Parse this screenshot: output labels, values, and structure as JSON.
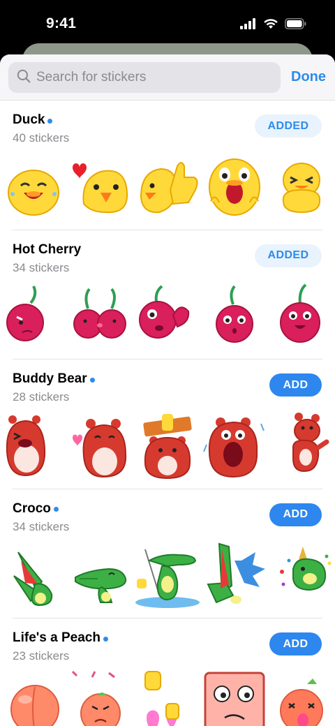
{
  "status_bar": {
    "time": "9:41"
  },
  "search": {
    "placeholder": "Search for stickers"
  },
  "header": {
    "done_label": "Done"
  },
  "packs": [
    {
      "title": "Duck",
      "is_new": true,
      "count": "40 stickers",
      "button": "ADDED",
      "added": true,
      "stickers": [
        "duck-laughing-sticker",
        "duck-heart-sticker",
        "duck-thumbs-up-sticker",
        "duck-shocked-sticker",
        "duck-squinting-sticker"
      ]
    },
    {
      "title": "Hot Cherry",
      "is_new": false,
      "count": "34 stickers",
      "button": "ADDED",
      "added": true,
      "stickers": [
        "cherry-sad-sticker",
        "cherry-pair-kiss-sticker",
        "cherry-waving-sticker",
        "cherry-surprised-sticker",
        "cherry-excited-sticker"
      ]
    },
    {
      "title": "Buddy Bear",
      "is_new": true,
      "count": "28 stickers",
      "button": "ADD",
      "added": false,
      "stickers": [
        "bear-laughing-sticker",
        "bear-blowing-kiss-sticker",
        "bear-thumbs-sign-sticker",
        "bear-screaming-sticker",
        "bear-dancing-sticker"
      ]
    },
    {
      "title": "Croco",
      "is_new": true,
      "count": "34 stickers",
      "button": "ADD",
      "added": false,
      "stickers": [
        "croco-laughing-sticker",
        "croco-lying-sticker",
        "croco-fishing-sticker",
        "croco-shouting-sticker",
        "croco-party-sticker"
      ]
    },
    {
      "title": "Life's a Peach",
      "is_new": true,
      "count": "23 stickers",
      "button": "ADD",
      "added": false,
      "stickers": [
        "peach-plain-sticker",
        "peach-angry-sticker",
        "peach-balloons-sticker",
        "peach-square-face-sticker",
        "peach-tongue-sticker"
      ]
    }
  ],
  "colors": {
    "accent": "#2d8bea",
    "added_bg": "#e9f3fd",
    "add_bg": "#2d87ee"
  }
}
